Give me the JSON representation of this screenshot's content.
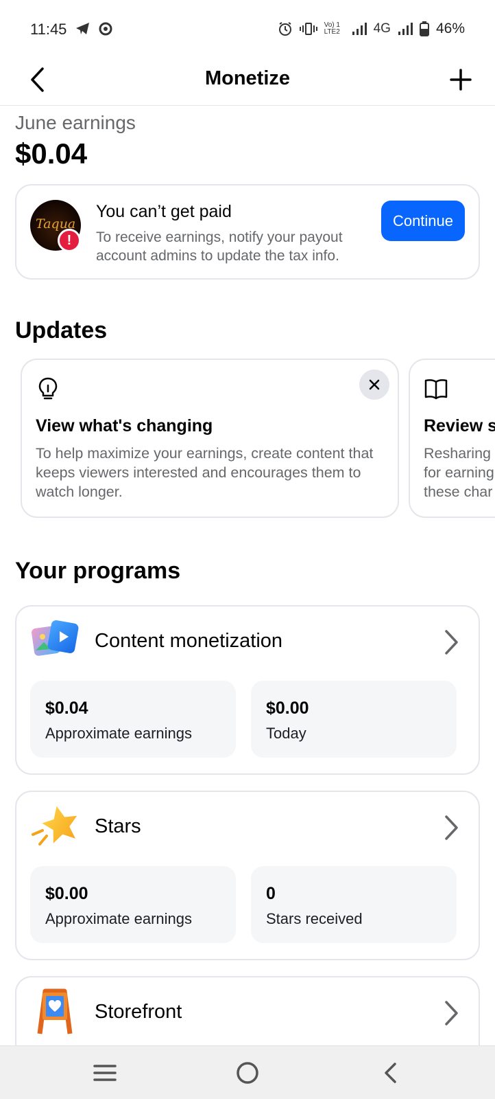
{
  "status_bar": {
    "time": "11:45",
    "network": "4G",
    "volte": "Vo) 1 LTE2",
    "battery": "46%"
  },
  "header": {
    "title": "Monetize"
  },
  "earnings": {
    "label": "June earnings",
    "amount": "$0.04"
  },
  "alert": {
    "avatar_text": "Taqua",
    "badge": "!",
    "title": "You can’t get paid",
    "description": "To receive earnings, notify your payout account admins to update the tax info.",
    "button": "Continue"
  },
  "updates": {
    "heading": "Updates",
    "cards": [
      {
        "icon": "lightbulb-icon",
        "title": "View what's changing",
        "description": "To help maximize your earnings, create content that keeps viewers interested and encourages them to watch longer."
      },
      {
        "icon": "book-icon",
        "title": "Review s",
        "description": "Resharing for earning these char"
      }
    ]
  },
  "programs": {
    "heading": "Your programs",
    "items": [
      {
        "name": "Content monetization",
        "icon": "content-monetization-icon",
        "stats": [
          {
            "value": "$0.04",
            "label": "Approximate earnings"
          },
          {
            "value": "$0.00",
            "label": "Today"
          }
        ]
      },
      {
        "name": "Stars",
        "icon": "star-icon",
        "stats": [
          {
            "value": "$0.00",
            "label": "Approximate earnings"
          },
          {
            "value": "0",
            "label": "Stars received"
          }
        ]
      },
      {
        "name": "Storefront",
        "icon": "storefront-icon"
      }
    ]
  },
  "colors": {
    "accent": "#0866ff",
    "alert_red": "#e41e3f",
    "secondary_text": "#65676b",
    "border": "#e4e6eb",
    "tile_bg": "#f5f6f8"
  }
}
